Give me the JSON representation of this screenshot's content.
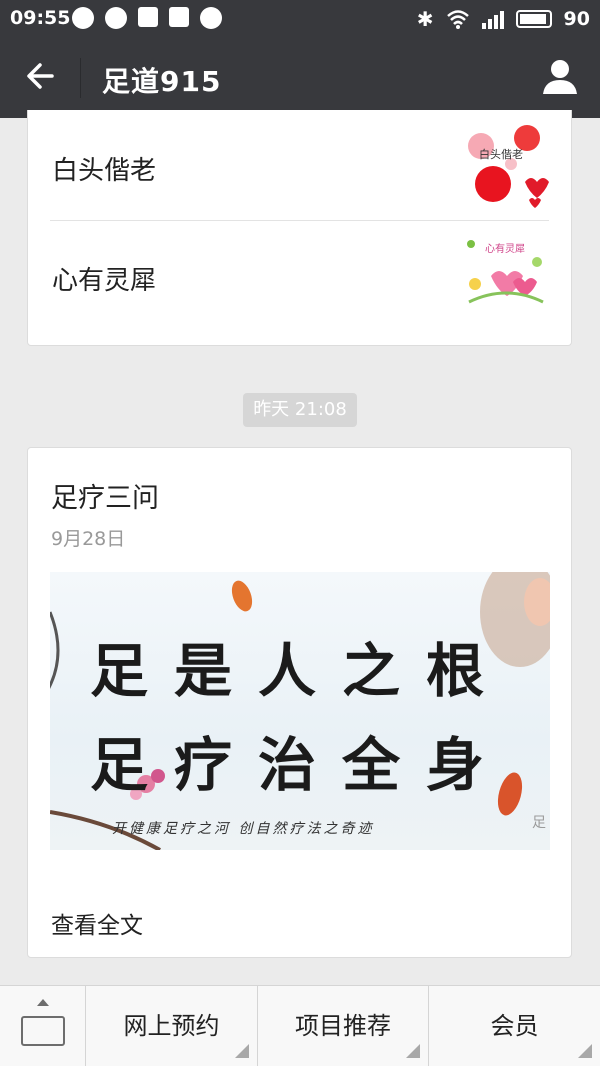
{
  "status_bar": {
    "time": "09:55",
    "battery": "90"
  },
  "header": {
    "title": "足道915"
  },
  "prev_article": {
    "items": [
      {
        "label": "白头偕老"
      },
      {
        "label": "心有灵犀"
      }
    ]
  },
  "timestamp": "昨天 21:08",
  "article": {
    "title": "足疗三问",
    "date": "9月28日",
    "banner_line1": "足是人之根",
    "banner_line2": "足疗治全身",
    "banner_footer": "开健康足疗之河  创自然疗法之奇迹",
    "banner_logo": "足",
    "read_more": "查看全文"
  },
  "menu": {
    "items": [
      {
        "label": "网上预约"
      },
      {
        "label": "项目推荐"
      },
      {
        "label": "会员"
      }
    ]
  }
}
